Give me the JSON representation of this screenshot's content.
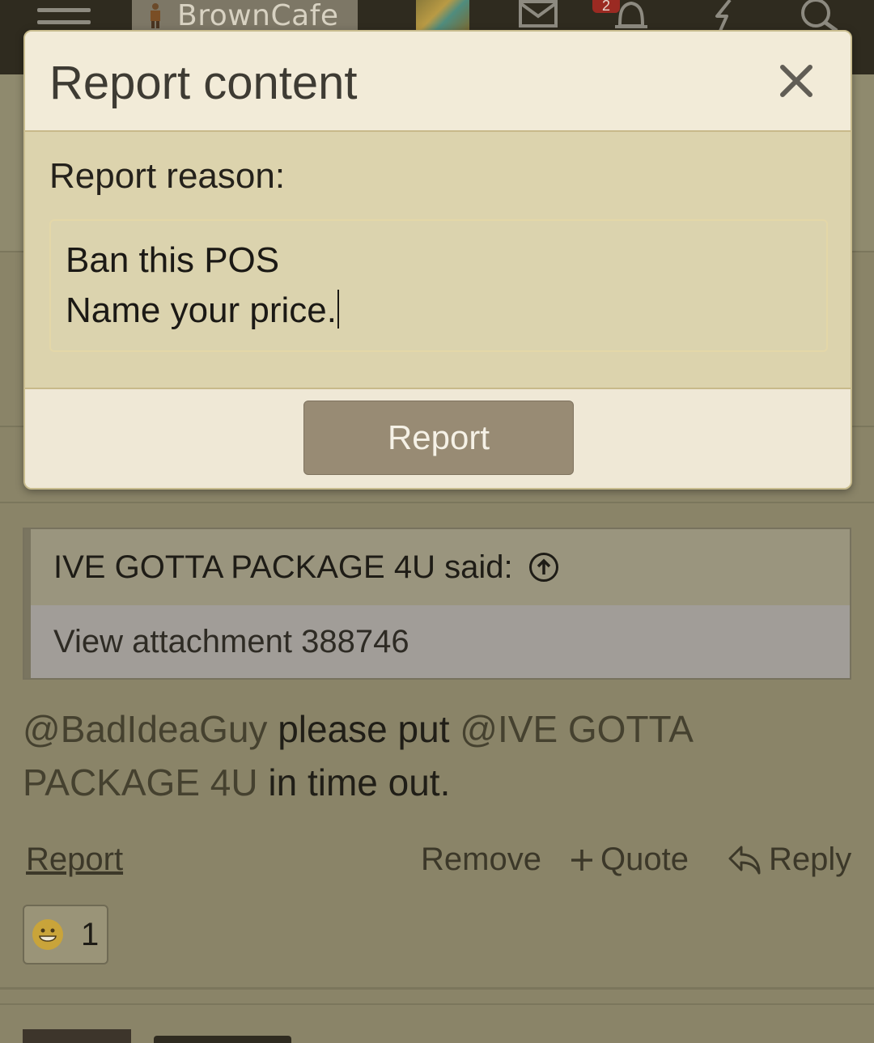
{
  "header": {
    "logo_text": "BrownCafe",
    "notification_count": "2"
  },
  "modal": {
    "title": "Report content",
    "reason_label": "Report reason:",
    "reason_lines": [
      "Ban this POS",
      "Name your price."
    ],
    "submit_label": "Report"
  },
  "post": {
    "quote_author": "IVE GOTTA PACKAGE 4U said:",
    "quote_body": "View attachment 388746",
    "text_mention_1": "@BadIdeaGuy",
    "text_mid": " please put ",
    "text_mention_2": "@IVE GOTTA PACKAGE 4U",
    "text_end": " in time out.",
    "actions": {
      "report": "Report",
      "remove": "Remove",
      "quote": "Quote",
      "reply": "Reply"
    },
    "reaction_count": "1"
  },
  "icons": [
    "menu-icon",
    "envelope-icon",
    "bell-icon",
    "lightning-icon",
    "search-icon",
    "close-icon",
    "arrow-up-circle-icon",
    "plus-icon",
    "reply-arrow-icon",
    "grin-emoji-icon"
  ]
}
